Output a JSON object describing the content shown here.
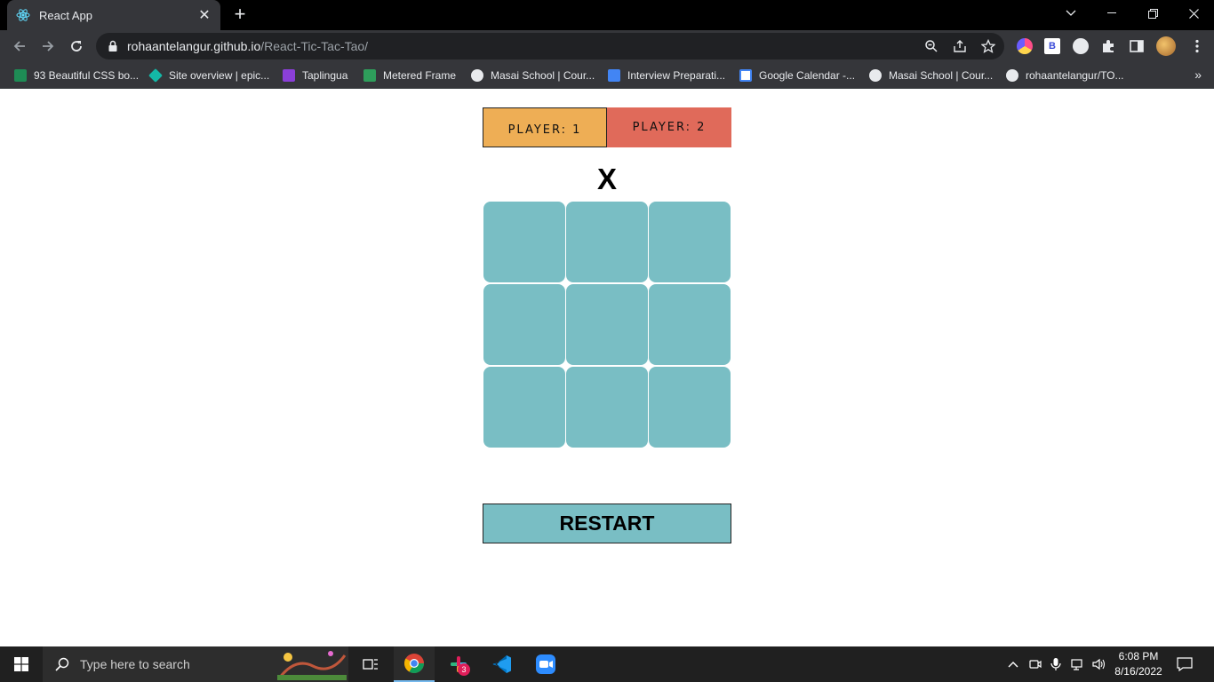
{
  "browser": {
    "tab_title": "React App",
    "tab_close": "✕",
    "new_tab": "+",
    "url_host": "rohaantelangur.github.io",
    "url_path": "/React-Tic-Tac-Tao/",
    "bookmarks": [
      "93 Beautiful CSS bo...",
      "Site overview | epic...",
      "Taplingua",
      "Metered Frame",
      "Masai School | Cour...",
      "Interview Preparati...",
      "Google Calendar -...",
      "Masai School | Cour...",
      "rohaantelangur/TO..."
    ],
    "bookmarks_more": "»"
  },
  "game": {
    "player1_label": "PLAYER: 1",
    "player2_label": "PLAYER: 2",
    "current_turn": "X",
    "cells": [
      "",
      "",
      "",
      "",
      "",
      "",
      "",
      "",
      ""
    ],
    "restart_label": "RESTART",
    "colors": {
      "player1_bg": "#eeae55",
      "player2_bg": "#e06a5a",
      "cell_bg": "#79bec4"
    }
  },
  "taskbar": {
    "search_placeholder": "Type here to search",
    "slack_badge": "3",
    "time": "6:08 PM",
    "date": "8/16/2022"
  }
}
